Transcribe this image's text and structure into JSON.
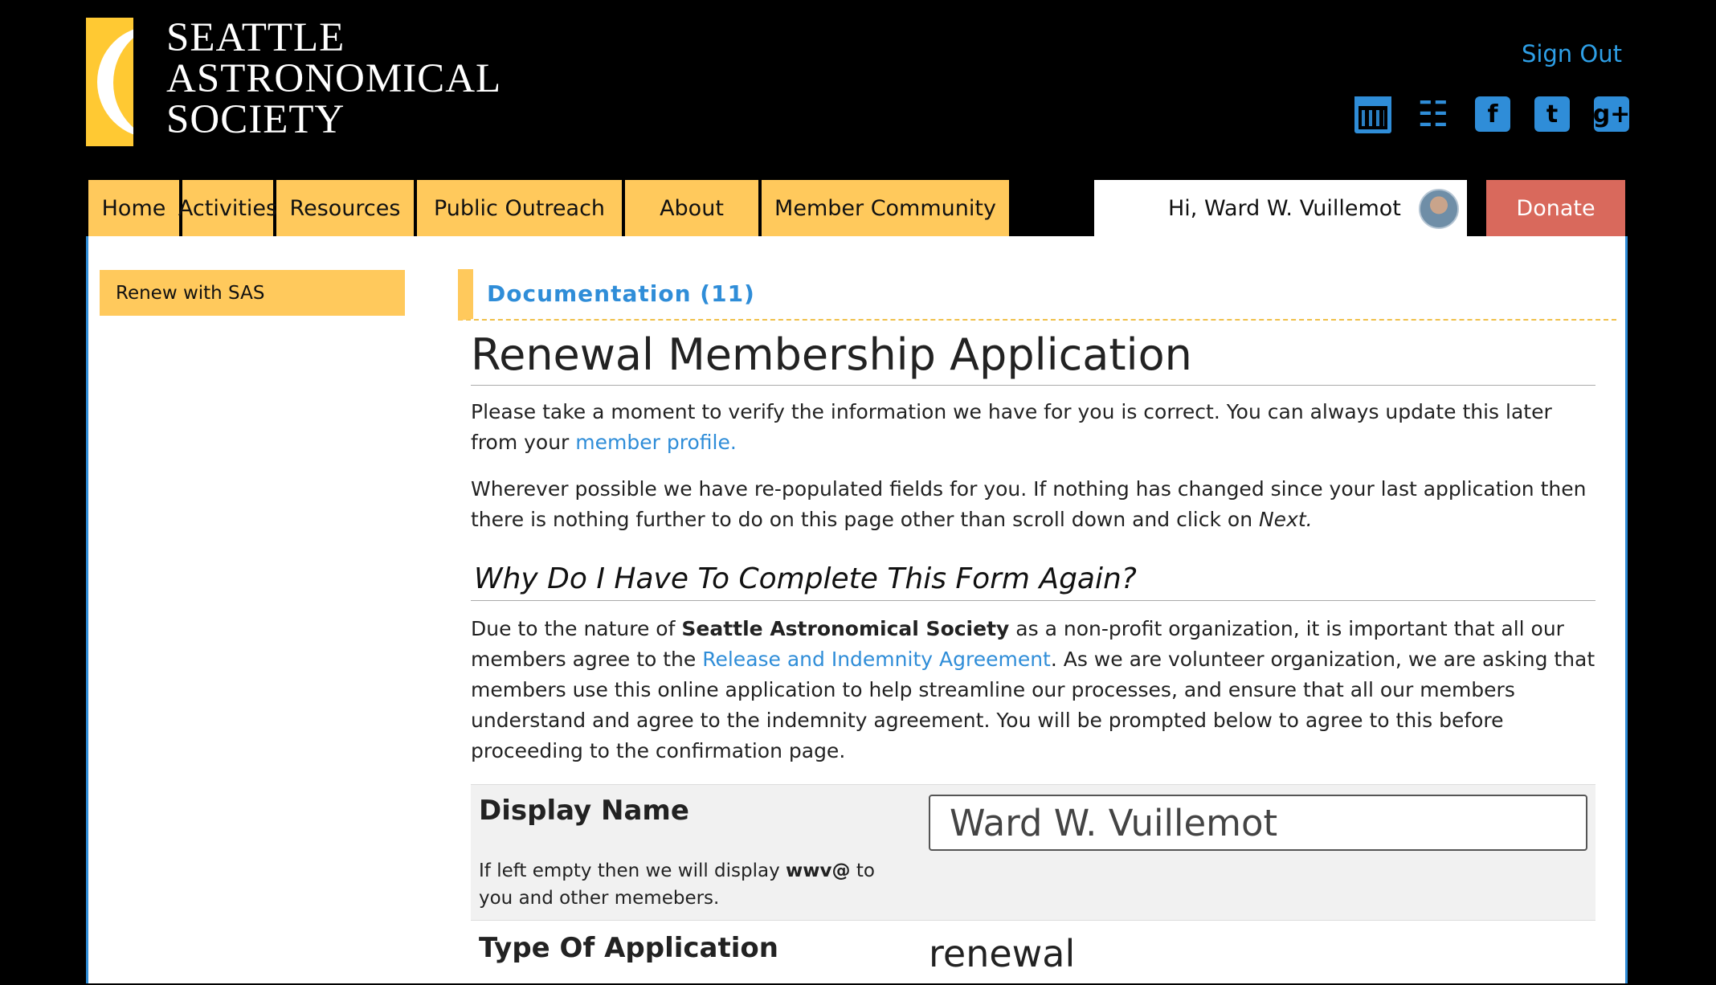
{
  "header": {
    "logo_lines": [
      "SEATTLE",
      "ASTRONOMICAL",
      "SOCIETY"
    ],
    "sign_out": "Sign Out",
    "social_icons": [
      "calendar-icon",
      "rss-icon",
      "facebook-icon",
      "twitter-icon",
      "google-plus-icon"
    ]
  },
  "nav": {
    "items": [
      "Home",
      "Activities",
      "Resources",
      "Public Outreach",
      "About",
      "Member Community"
    ],
    "greeting": "Hi, Ward W. Vuillemot",
    "donate": "Donate"
  },
  "sidebar": {
    "items": [
      "Renew with SAS"
    ]
  },
  "main": {
    "doc_link": "Documentation (11)",
    "title": "Renewal Membership Application",
    "intro_1": "Please take a moment to verify the information we have for you is correct. You can always update this later from your ",
    "intro_1_link": "member profile.",
    "intro_2": "Wherever possible we have re-populated fields for you. If nothing has changed since your last application then there is nothing further to do on this page other than scroll down and click on ",
    "intro_2_em": "Next.",
    "why_heading": "Why Do I Have To Complete This Form Again?",
    "why_1": "Due to the nature of ",
    "why_org": "Seattle Astronomical Society",
    "why_2": " as a non-profit organization, it is important that all our members agree to the ",
    "why_link": "Release and Indemnity Agreement",
    "why_3": ". As we are volunteer organization, we are asking that members use this online application to help streamline our processes, and ensure that all our members understand and agree to the indemnity agreement. You will be prompted below to agree to this before proceeding to the confirmation page."
  },
  "form": {
    "display_name_label": "Display Name",
    "display_name_value": "Ward W. Vuillemot",
    "display_name_help_1": "If left empty then we will display ",
    "display_name_help_handle": "wwv@",
    "display_name_help_2": " to you and other memebers.",
    "type_label": "Type Of Application",
    "type_value": "renewal"
  },
  "colors": {
    "accent_blue": "#2f8dd8",
    "nav_yellow": "#ffc95c",
    "donate_red": "#d9695c",
    "background": "#000000"
  }
}
